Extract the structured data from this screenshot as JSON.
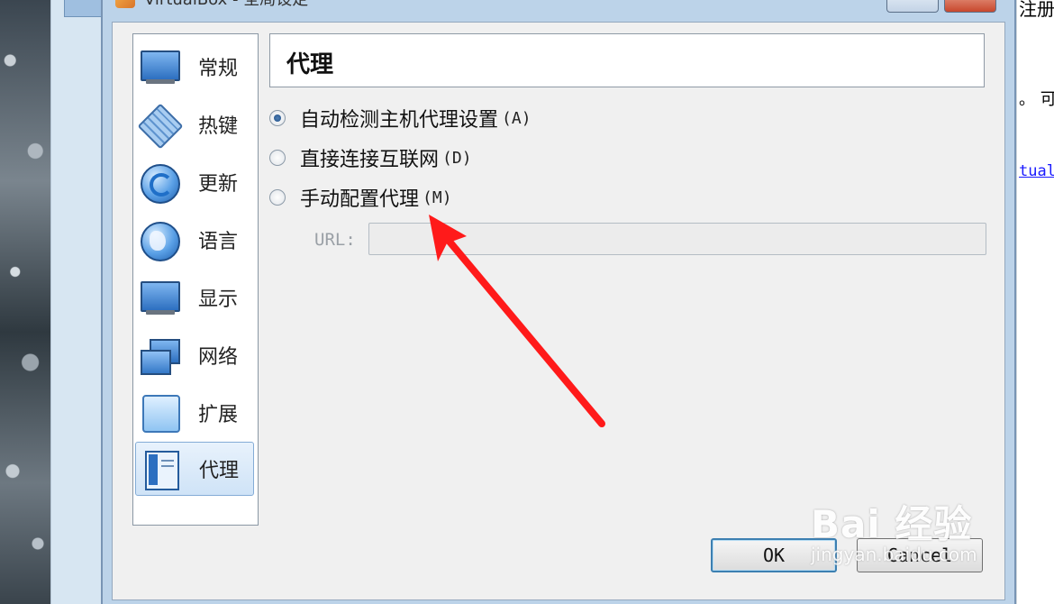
{
  "window": {
    "title": "VirtualBox - 全局设定",
    "buttons": [
      "maximize-button",
      "close-button"
    ]
  },
  "sidebar": {
    "items": [
      {
        "label": "常规",
        "icon": "monitor-icon"
      },
      {
        "label": "热键",
        "icon": "keyboard-icon"
      },
      {
        "label": "更新",
        "icon": "refresh-globe-icon"
      },
      {
        "label": "语言",
        "icon": "globe-icon"
      },
      {
        "label": "显示",
        "icon": "display-icon"
      },
      {
        "label": "网络",
        "icon": "network-icon"
      },
      {
        "label": "扩展",
        "icon": "extension-icon"
      },
      {
        "label": "代理",
        "icon": "proxy-icon",
        "selected": true
      }
    ]
  },
  "page": {
    "title": "代理"
  },
  "proxy": {
    "options": [
      {
        "label": "自动检测主机代理设置",
        "key": "(A)",
        "checked": true
      },
      {
        "label": "直接连接互联网",
        "key": "(D)",
        "checked": false
      },
      {
        "label": "手动配置代理",
        "key": "(M)",
        "checked": false
      }
    ],
    "url_label": "URL:",
    "url_value": ""
  },
  "buttons": {
    "ok": "OK",
    "cancel": "Cancel"
  },
  "background": {
    "right_text_1": "注册",
    "right_text_2": "。 可",
    "right_link": "tual"
  },
  "watermark": {
    "brand": "Bai 经验",
    "site": "jingyan.baidu.com"
  },
  "annotation": {
    "arrow_color": "#ff1a1a"
  }
}
